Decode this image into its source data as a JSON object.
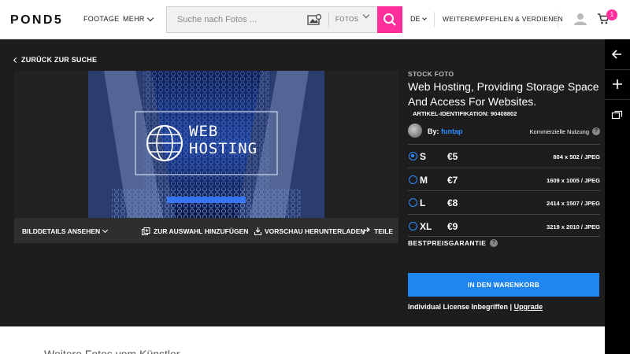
{
  "header": {
    "logo": "POND5",
    "nav_footage": "FOOTAGE",
    "nav_mehr": "MEHR",
    "search_placeholder": "Suche nach Fotos ...",
    "search_category": "FOTOS",
    "lang": "DE",
    "refer": "WEITEREMPFEHLEN & VERDIENEN",
    "cart_count": "1",
    "accent": "#ff2e9a"
  },
  "main": {
    "back_label": "ZURÜCK ZUR SUCHE",
    "photo_text": [
      "WEB",
      "HOSTING"
    ],
    "toolbar": {
      "details": "BILDDETAILS ANSEHEN",
      "add": "ZUR AUSWAHL HINZUFÜGEN",
      "preview": "VORSCHAU HERUNTERLADEN",
      "share": "TEILE"
    }
  },
  "product": {
    "type": "STOCK FOTO",
    "title": "Web Hosting, Providing Storage Space And Access For Websites.",
    "article_id": "ARTIKEL-IDENTIFIKATION: 90408802",
    "by_label": "By:",
    "author": "funtap",
    "usage": "Kommerzielle Nutzung",
    "sizes": [
      {
        "size": "S",
        "price": "€5",
        "dims": "804 x 502 / JPEG",
        "selected": true
      },
      {
        "size": "M",
        "price": "€7",
        "dims": "1609 x 1005 / JPEG",
        "selected": false
      },
      {
        "size": "L",
        "price": "€8",
        "dims": "2414 x 1507 / JPEG",
        "selected": false
      },
      {
        "size": "XL",
        "price": "€9",
        "dims": "3219 x 2010 / JPEG",
        "selected": false
      }
    ],
    "best_price": "BESTPREISGARANTIE",
    "cart_button": "IN DEN WARENKORB",
    "license_text": "Individual License Inbegriffen",
    "upgrade": "Upgrade",
    "button_color": "#1f86f0"
  },
  "below": {
    "more_title": "Weitere Fotos vom Künstler"
  }
}
